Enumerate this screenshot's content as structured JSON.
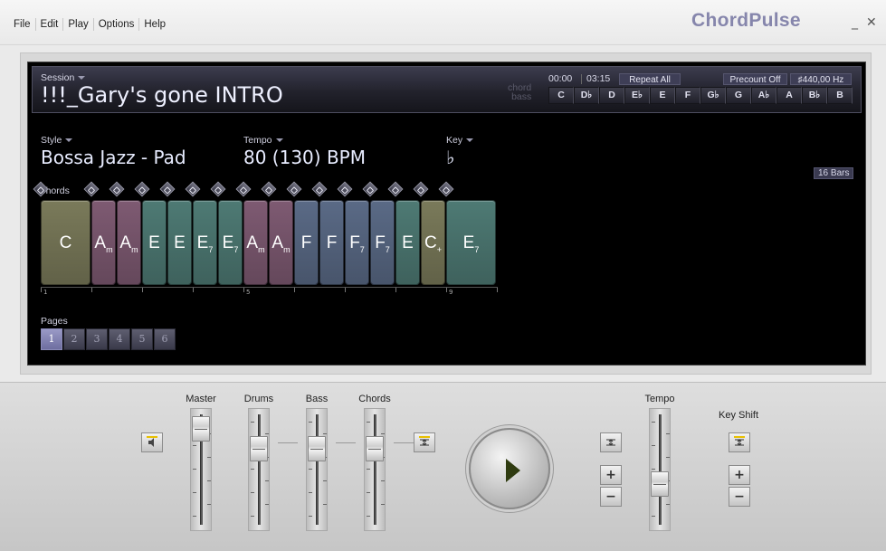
{
  "app": {
    "menu": [
      "File",
      "Edit",
      "Play",
      "Options",
      "Help"
    ],
    "brand": "ChordPulse",
    "minimize": "_",
    "close": "✕"
  },
  "session": {
    "label": "Session",
    "title": "!!!_Gary's gone INTRO",
    "time_current": "00:00",
    "time_total": "03:15",
    "repeat": "Repeat All",
    "precount": "Precount Off",
    "tuning": "♯440,00 Hz",
    "chord_label": "chord",
    "bass_label": "bass",
    "keys": [
      "C",
      "D♭",
      "D",
      "E♭",
      "E",
      "F",
      "G♭",
      "G",
      "A♭",
      "A",
      "B♭",
      "B"
    ]
  },
  "style": {
    "label": "Style",
    "value": "Bossa Jazz - Pad"
  },
  "tempo": {
    "label": "Tempo",
    "value": "80 (130) BPM"
  },
  "key": {
    "label": "Key",
    "value": "♭"
  },
  "bars": "16 Bars",
  "chords_label": "Chords",
  "chords": [
    {
      "name": "C",
      "sub": "",
      "color": "#7a7a5a",
      "beats": 4
    },
    {
      "name": "A",
      "sub": "m",
      "color": "#7e5a72",
      "beats": 2
    },
    {
      "name": "A",
      "sub": "m",
      "color": "#7e5a72",
      "beats": 2
    },
    {
      "name": "E",
      "sub": "",
      "color": "#4e7a74",
      "beats": 2
    },
    {
      "name": "E",
      "sub": "",
      "color": "#4e7a74",
      "beats": 2
    },
    {
      "name": "E",
      "sub": "7",
      "color": "#4e7a74",
      "beats": 2
    },
    {
      "name": "E",
      "sub": "7",
      "color": "#4e7a74",
      "beats": 2
    },
    {
      "name": "A",
      "sub": "m",
      "color": "#7e5a72",
      "beats": 2
    },
    {
      "name": "A",
      "sub": "m",
      "color": "#7e5a72",
      "beats": 2
    },
    {
      "name": "F",
      "sub": "",
      "color": "#5a6a86",
      "beats": 2
    },
    {
      "name": "F",
      "sub": "",
      "color": "#5a6a86",
      "beats": 2
    },
    {
      "name": "F",
      "sub": "7",
      "color": "#5a6a86",
      "beats": 2
    },
    {
      "name": "F",
      "sub": "7",
      "color": "#5a6a86",
      "beats": 2
    },
    {
      "name": "E",
      "sub": "",
      "color": "#4e7a74",
      "beats": 2
    },
    {
      "name": "C",
      "sub": "+",
      "color": "#7a7a5a",
      "beats": 2
    },
    {
      "name": "E",
      "sub": "7",
      "color": "#4e7a74",
      "beats": 4
    }
  ],
  "ruler_marks": [
    "1",
    "5",
    "9"
  ],
  "pages": {
    "label": "Pages",
    "items": [
      "1",
      "2",
      "3",
      "4",
      "5",
      "6"
    ],
    "active": "1"
  },
  "mixer": {
    "master": {
      "label": "Master",
      "level": 0.92
    },
    "drums": {
      "label": "Drums",
      "level": 0.72
    },
    "bass": {
      "label": "Bass",
      "level": 0.72
    },
    "chords": {
      "label": "Chords",
      "level": 0.72
    },
    "tempo": {
      "label": "Tempo",
      "level": 0.35
    },
    "key_shift": {
      "label": "Key Shift"
    },
    "plus": "+",
    "minus": "−"
  }
}
